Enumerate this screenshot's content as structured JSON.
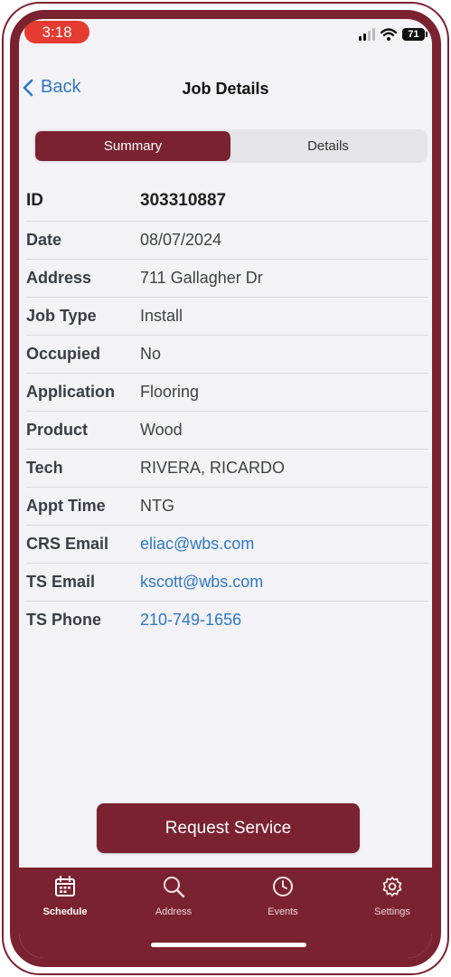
{
  "status_bar": {
    "time": "3:18",
    "battery": "71"
  },
  "nav": {
    "back_label": "Back",
    "title": "Job Details"
  },
  "segments": [
    {
      "label": "Summary",
      "active": true
    },
    {
      "label": "Details",
      "active": false
    }
  ],
  "details": [
    {
      "label": "ID",
      "value": "303310887"
    },
    {
      "label": "Date",
      "value": "08/07/2024"
    },
    {
      "label": "Address",
      "value": "711 Gallagher Dr"
    },
    {
      "label": "Job Type",
      "value": "Install"
    },
    {
      "label": "Occupied",
      "value": "No"
    },
    {
      "label": "Application",
      "value": "Flooring"
    },
    {
      "label": "Product",
      "value": "Wood"
    },
    {
      "label": "Tech",
      "value": "RIVERA, RICARDO"
    },
    {
      "label": "Appt Time",
      "value": "NTG"
    },
    {
      "label": "CRS Email",
      "value": "eliac@wbs.com"
    },
    {
      "label": "TS Email",
      "value": "kscott@wbs.com"
    },
    {
      "label": "TS Phone",
      "value": "210-749-1656"
    }
  ],
  "request_button": "Request Service",
  "tabs": [
    {
      "label": "Schedule",
      "icon": "calendar-icon"
    },
    {
      "label": "Address",
      "icon": "search-icon"
    },
    {
      "label": "Events",
      "icon": "clock-icon"
    },
    {
      "label": "Settings",
      "icon": "gear-icon"
    }
  ],
  "colors": {
    "brand": "#7b2230",
    "link": "#2f78c4",
    "time_pill": "#e53b30"
  }
}
